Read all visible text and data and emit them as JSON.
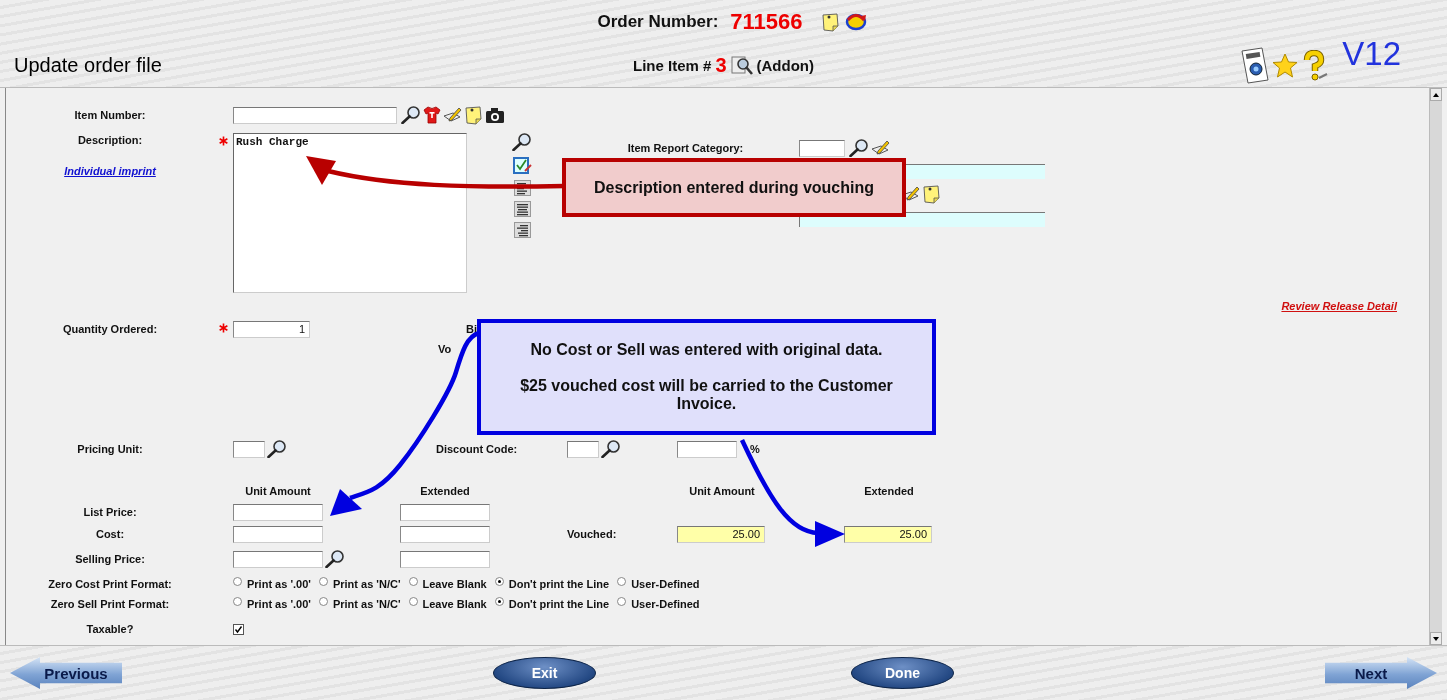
{
  "header": {
    "order_number_label": "Order Number:",
    "order_number": "711566",
    "title": "Update order file",
    "line_item_label": "Line Item #",
    "line_item_number": "3",
    "line_item_type": "(Addon)",
    "version": "V12"
  },
  "form": {
    "item_number": {
      "label": "Item Number:"
    },
    "description": {
      "label": "Description:",
      "required": true,
      "value": "Rush Charge"
    },
    "imprint_link": "Individual imprint",
    "item_report_category": {
      "label": "Item Report Category:"
    },
    "review_link": "Review Release Detail",
    "quantity_ordered": {
      "label": "Quantity Ordered:",
      "required": true,
      "value": "1"
    },
    "partial_labels": [
      "Bi",
      "Vo"
    ],
    "pricing_unit": {
      "label": "Pricing Unit:"
    },
    "discount_code": {
      "label": "Discount Code:",
      "percent_sign": "%"
    },
    "amount_headers": [
      "Unit Amount",
      "Extended"
    ],
    "vouched_headers": [
      "Unit Amount",
      "Extended"
    ],
    "prices": [
      {
        "label": "List Price:"
      },
      {
        "label": "Cost:",
        "vouched": {
          "label": "Vouched:",
          "unit_amount": "25.00",
          "extended": "25.00"
        }
      },
      {
        "label": "Selling Price:",
        "lookup": true
      }
    ],
    "print_formats": [
      {
        "label": "Zero Cost Print Format:",
        "options": [
          {
            "label": "Print as '.00'",
            "selected": false
          },
          {
            "label": "Print as 'N/C'",
            "selected": false
          },
          {
            "label": "Leave Blank",
            "selected": false
          },
          {
            "label": "Don't print the Line",
            "selected": true
          },
          {
            "label": "User-Defined",
            "selected": false
          }
        ]
      },
      {
        "label": "Zero Sell Print Format:",
        "options": [
          {
            "label": "Print as '.00'",
            "selected": false
          },
          {
            "label": "Print as 'N/C'",
            "selected": false
          },
          {
            "label": "Leave Blank",
            "selected": false
          },
          {
            "label": "Don't print the Line",
            "selected": true
          },
          {
            "label": "User-Defined",
            "selected": false
          }
        ]
      }
    ],
    "taxable": {
      "label": "Taxable?",
      "checked": true
    }
  },
  "callouts": [
    {
      "color": "#b80000",
      "paragraphs": [
        "Description entered during vouching"
      ]
    },
    {
      "color": "#0000e0",
      "paragraphs": [
        "No Cost or Sell was entered with original data.",
        "$25 vouched cost will be carried to the Customer Invoice."
      ]
    }
  ],
  "footer": {
    "buttons": [
      {
        "label": "Previous",
        "kind": "back"
      },
      {
        "label": "Exit",
        "kind": "oval"
      },
      {
        "label": "Done",
        "kind": "oval"
      },
      {
        "label": "Next",
        "kind": "forward"
      }
    ]
  }
}
